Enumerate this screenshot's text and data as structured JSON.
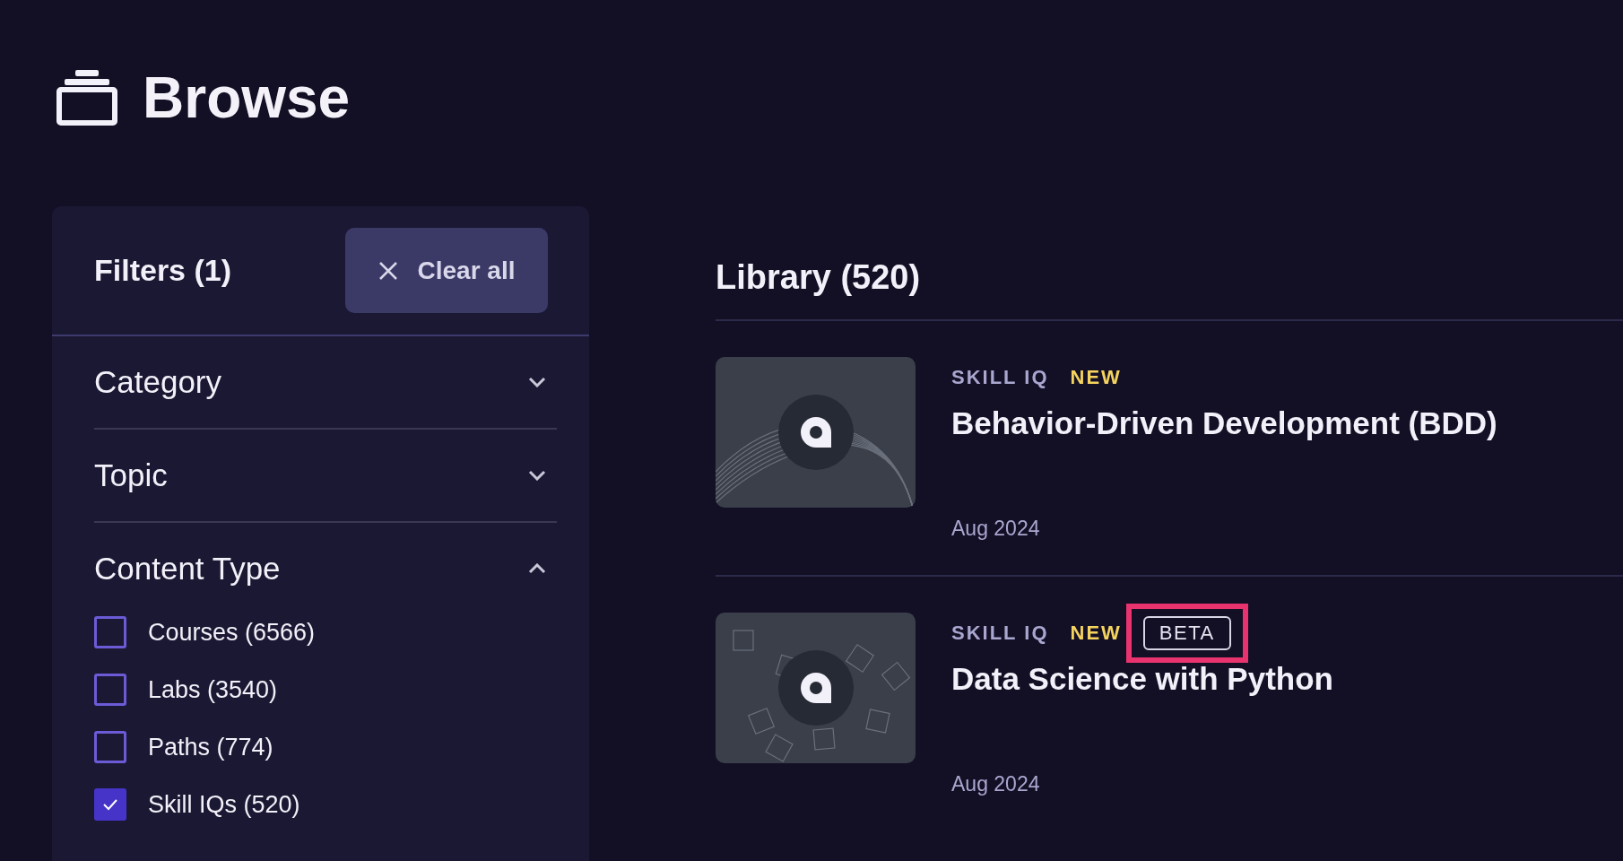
{
  "page_title": "Browse",
  "filters": {
    "title": "Filters (1)",
    "clear_button": "Clear all",
    "sections": [
      {
        "label": "Category",
        "expanded": false
      },
      {
        "label": "Topic",
        "expanded": false
      },
      {
        "label": "Content Type",
        "expanded": true,
        "options": [
          {
            "label": "Courses (6566)",
            "checked": false
          },
          {
            "label": "Labs (3540)",
            "checked": false
          },
          {
            "label": "Paths (774)",
            "checked": false
          },
          {
            "label": "Skill IQs (520)",
            "checked": true
          }
        ]
      }
    ]
  },
  "library": {
    "title": "Library (520)",
    "items": [
      {
        "type": "SKILL IQ",
        "badges": [
          {
            "kind": "new",
            "label": "NEW",
            "highlighted": false
          }
        ],
        "title": "Behavior-Driven Development (BDD)",
        "date": "Aug 2024",
        "kind": "waves"
      },
      {
        "type": "SKILL IQ",
        "badges": [
          {
            "kind": "new",
            "label": "NEW",
            "highlighted": false
          },
          {
            "kind": "outline",
            "label": "BETA",
            "highlighted": true
          }
        ],
        "title": "Data Science with Python",
        "date": "Aug 2024",
        "kind": "cubes"
      }
    ]
  }
}
